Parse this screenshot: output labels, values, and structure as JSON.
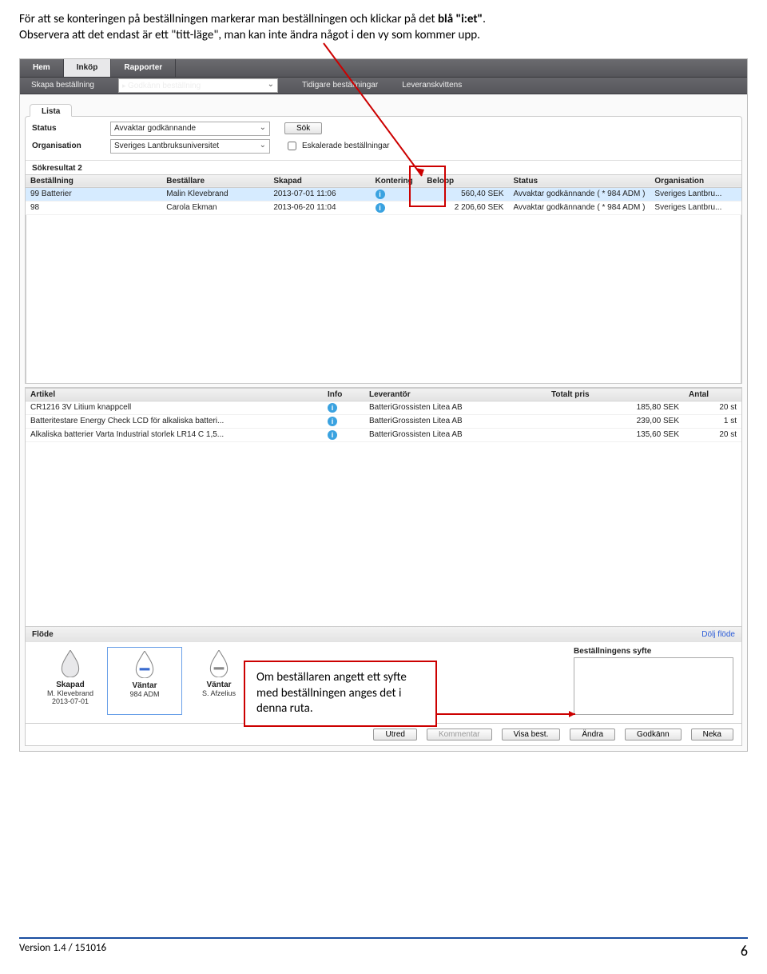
{
  "intro": {
    "line1a": "För att se konteringen på beställningen markerar man beställningen och klickar på det ",
    "line1b": "blå \"i:et\"",
    "line1c": ".",
    "line2": "Observera att det endast är ett \"titt-läge\", man kan inte ändra något i den vy som kommer upp."
  },
  "topbar": {
    "hem": "Hem",
    "inkop": "Inköp",
    "rapporter": "Rapporter"
  },
  "subbar": {
    "skapa": "Skapa beställning",
    "godkann": "Godkänn beställning",
    "tidigare": "Tidigare beställningar",
    "leverans": "Leveranskvittens"
  },
  "lista": {
    "tab": "Lista",
    "status_lbl": "Status",
    "status_val": "Avvaktar godkännande",
    "org_lbl": "Organisation",
    "org_val": "Sveriges Lantbruksuniversitet",
    "sok": "Sök",
    "esk": "Eskalerade beställningar",
    "sokres": "Sökresultat 2"
  },
  "grid1": {
    "cols": {
      "best": "Beställning",
      "bestallare": "Beställare",
      "skapad": "Skapad",
      "kontering": "Kontering",
      "belopp": "Belopp",
      "status": "Status",
      "org": "Organisation"
    },
    "rows": [
      {
        "best": "99 Batterier",
        "bestallare": "Malin Klevebrand",
        "skapad": "2013-07-01 11:06",
        "belopp": "560,40 SEK",
        "status": "Avvaktar godkännande  ( * 984 ADM )",
        "org": "Sveriges Lantbru..."
      },
      {
        "best": "98",
        "bestallare": "Carola Ekman",
        "skapad": "2013-06-20 11:04",
        "belopp": "2 206,60 SEK",
        "status": "Avvaktar godkännande  ( * 984 ADM )",
        "org": "Sveriges Lantbru..."
      }
    ]
  },
  "grid2": {
    "cols": {
      "artikel": "Artikel",
      "info": "Info",
      "lev": "Leverantör",
      "pris": "Totalt pris",
      "antal": "Antal"
    },
    "rows": [
      {
        "artikel": "CR1216 3V Litium knappcell",
        "lev": "BatteriGrossisten Litea AB",
        "pris": "185,80 SEK",
        "antal": "20 st"
      },
      {
        "artikel": "Batteritestare Energy Check LCD för alkaliska batteri...",
        "lev": "BatteriGrossisten Litea AB",
        "pris": "239,00 SEK",
        "antal": "1 st"
      },
      {
        "artikel": "Alkaliska batterier Varta Industrial storlek LR14 C 1,5...",
        "lev": "BatteriGrossisten Litea AB",
        "pris": "135,60 SEK",
        "antal": "20 st"
      }
    ]
  },
  "flow": {
    "title": "Flöde",
    "dolj": "Dölj flöde",
    "cols": [
      {
        "lbl": "Skapad",
        "sub1": "M. Klevebrand",
        "sub2": "2013-07-01"
      },
      {
        "lbl": "Väntar",
        "sub1": "984 ADM",
        "sub2": ""
      },
      {
        "lbl": "Väntar",
        "sub1": "S. Afzelius",
        "sub2": ""
      }
    ],
    "syfte_t": "Beställningens syfte"
  },
  "buttons": {
    "utred": "Utred",
    "kommentar": "Kommentar",
    "visa": "Visa best.",
    "andra": "Ändra",
    "godkann": "Godkänn",
    "neka": "Neka"
  },
  "callout": "Om beställaren angett ett syfte med beställningen anges det i denna ruta.",
  "footer": {
    "ver": "Version 1.4 / 151016",
    "page": "6"
  }
}
